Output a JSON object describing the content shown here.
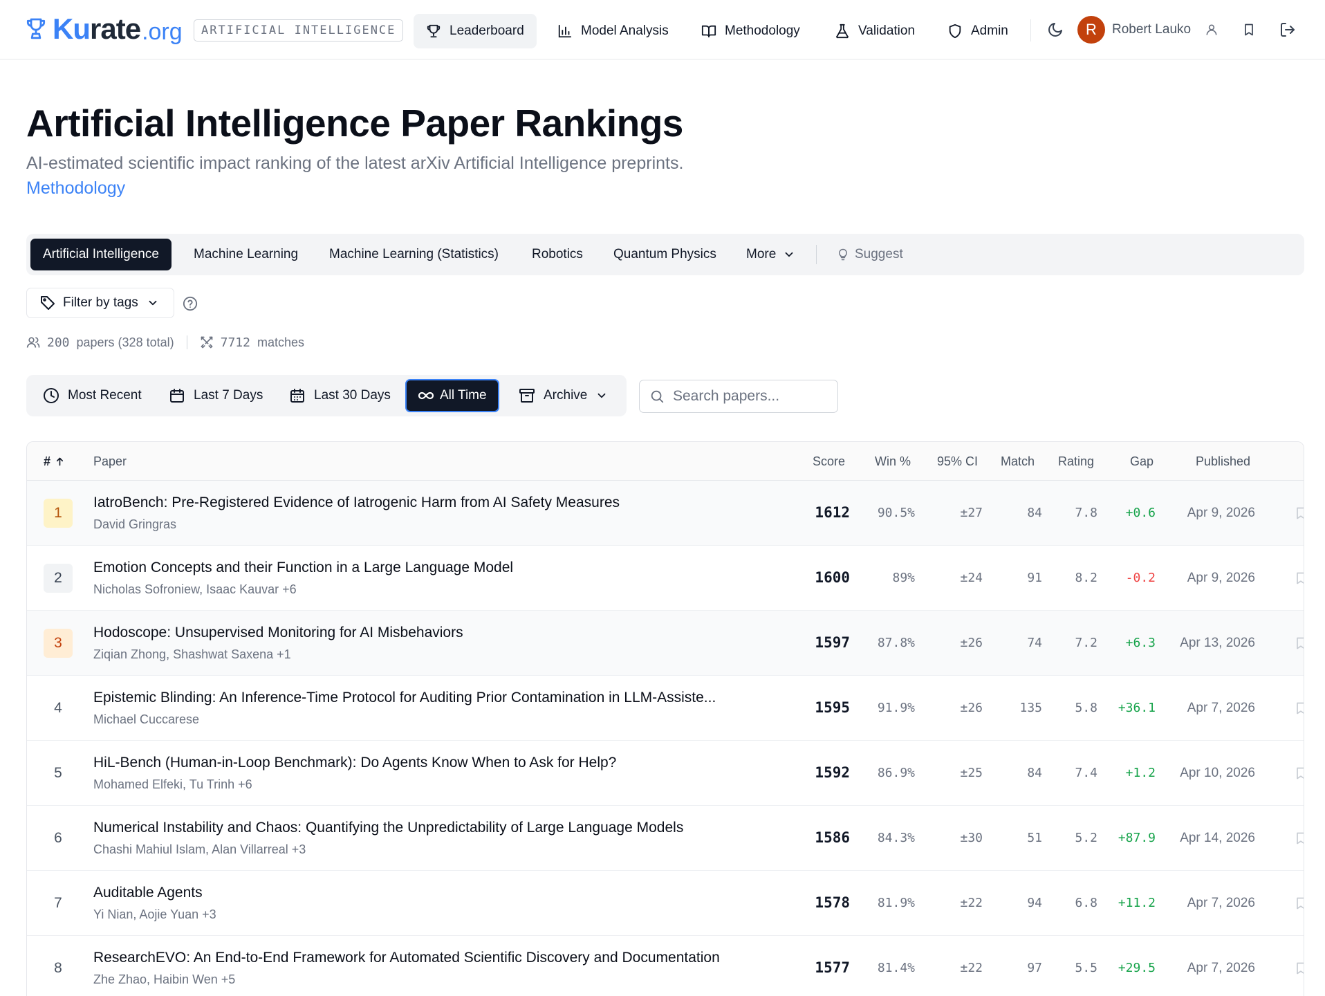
{
  "brand": {
    "ku": "Ku",
    "rate": "rate",
    "org": ".org",
    "domain_tag": "ARTIFICIAL INTELLIGENCE"
  },
  "nav": {
    "leaderboard": "Leaderboard",
    "model_analysis": "Model Analysis",
    "methodology": "Methodology",
    "validation": "Validation",
    "admin": "Admin",
    "avatar_letter": "R",
    "user_name": "Robert Lauko"
  },
  "page": {
    "title": "Artificial Intelligence Paper Rankings",
    "subtitle": "AI-estimated scientific impact ranking of the latest arXiv Artificial Intelligence preprints.",
    "methodology_link": "Methodology"
  },
  "categories": {
    "items": [
      "Artificial Intelligence",
      "Machine Learning",
      "Machine Learning (Statistics)",
      "Robotics",
      "Quantum Physics"
    ],
    "more": "More",
    "suggest": "Suggest"
  },
  "filter": {
    "label": "Filter by tags"
  },
  "stats": {
    "papers_count": "200",
    "papers_label": "papers (328 total)",
    "matches_count": "7712",
    "matches_label": "matches"
  },
  "time_filters": {
    "most_recent": "Most Recent",
    "last_7": "Last 7 Days",
    "last_30": "Last 30 Days",
    "all_time": "All Time",
    "archive": "Archive"
  },
  "search": {
    "placeholder": "Search papers..."
  },
  "table": {
    "headers": {
      "rank": "#",
      "paper": "Paper",
      "score": "Score",
      "win": "Win %",
      "ci": "95% CI",
      "match": "Match",
      "rating": "Rating",
      "gap": "Gap",
      "published": "Published"
    },
    "rows": [
      {
        "rank": "1",
        "title": "IatroBench: Pre-Registered Evidence of Iatrogenic Harm from AI Safety Measures",
        "authors": "David Gringras",
        "score": "1612",
        "win": "90.5%",
        "ci": "±27",
        "match": "84",
        "rating": "7.8",
        "gap": "+0.6",
        "published": "Apr 9, 2026"
      },
      {
        "rank": "2",
        "title": "Emotion Concepts and their Function in a Large Language Model",
        "authors": "Nicholas Sofroniew, Isaac Kauvar +6",
        "score": "1600",
        "win": "89%",
        "ci": "±24",
        "match": "91",
        "rating": "8.2",
        "gap": "-0.2",
        "published": "Apr 9, 2026"
      },
      {
        "rank": "3",
        "title": "Hodoscope: Unsupervised Monitoring for AI Misbehaviors",
        "authors": "Ziqian Zhong, Shashwat Saxena +1",
        "score": "1597",
        "win": "87.8%",
        "ci": "±26",
        "match": "74",
        "rating": "7.2",
        "gap": "+6.3",
        "published": "Apr 13, 2026"
      },
      {
        "rank": "4",
        "title": "Epistemic Blinding: An Inference-Time Protocol for Auditing Prior Contamination in LLM-Assiste...",
        "authors": "Michael Cuccarese",
        "score": "1595",
        "win": "91.9%",
        "ci": "±26",
        "match": "135",
        "rating": "5.8",
        "gap": "+36.1",
        "published": "Apr 7, 2026"
      },
      {
        "rank": "5",
        "title": "HiL-Bench (Human-in-Loop Benchmark): Do Agents Know When to Ask for Help?",
        "authors": "Mohamed Elfeki, Tu Trinh +6",
        "score": "1592",
        "win": "86.9%",
        "ci": "±25",
        "match": "84",
        "rating": "7.4",
        "gap": "+1.2",
        "published": "Apr 10, 2026"
      },
      {
        "rank": "6",
        "title": "Numerical Instability and Chaos: Quantifying the Unpredictability of Large Language Models",
        "authors": "Chashi Mahiul Islam, Alan Villarreal +3",
        "score": "1586",
        "win": "84.3%",
        "ci": "±30",
        "match": "51",
        "rating": "5.2",
        "gap": "+87.9",
        "published": "Apr 14, 2026"
      },
      {
        "rank": "7",
        "title": "Auditable Agents",
        "authors": "Yi Nian, Aojie Yuan +3",
        "score": "1578",
        "win": "81.9%",
        "ci": "±22",
        "match": "94",
        "rating": "6.8",
        "gap": "+11.2",
        "published": "Apr 7, 2026"
      },
      {
        "rank": "8",
        "title": "ResearchEVO: An End-to-End Framework for Automated Scientific Discovery and Documentation",
        "authors": "Zhe Zhao, Haibin Wen +5",
        "score": "1577",
        "win": "81.4%",
        "ci": "±22",
        "match": "97",
        "rating": "5.5",
        "gap": "+29.5",
        "published": "Apr 7, 2026"
      }
    ]
  },
  "colors": {
    "accent": "#3b82f6",
    "dark": "#111827",
    "positive": "#16a34a",
    "negative": "#ef4444",
    "gold": "#fef3c7",
    "bronze": "#ffedd5"
  }
}
